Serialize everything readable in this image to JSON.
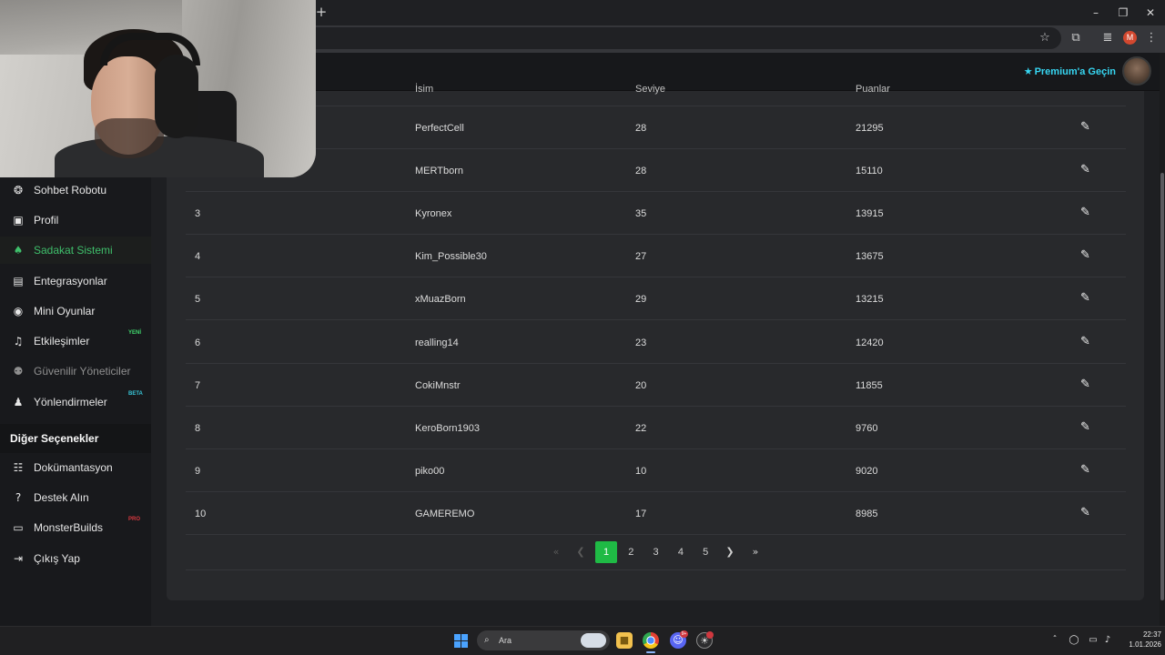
{
  "browser": {
    "new_tab": "+",
    "minimize": "–",
    "maximize": "❐",
    "close": "✕",
    "bookmark_icon": "☆",
    "extensions_icon": "⧉",
    "media_icon": "≣",
    "profile_initial": "M",
    "menu_icon": "⋮"
  },
  "header": {
    "premium_star": "★",
    "premium_label": "Premium'a Geçin"
  },
  "sidebar": {
    "items": [
      {
        "label": "Sohbet Robotu",
        "icon": "❂",
        "icon_name": "robot-icon"
      },
      {
        "label": "Profil",
        "icon": "▣",
        "icon_name": "id-card-icon"
      },
      {
        "label": "Sadakat Sistemi",
        "icon": "♠",
        "icon_name": "trophy-icon",
        "active": true
      },
      {
        "label": "Entegrasyonlar",
        "icon": "▤",
        "icon_name": "integration-icon"
      },
      {
        "label": "Mini Oyunlar",
        "icon": "◉",
        "icon_name": "gamepad-icon"
      },
      {
        "label": "Etkileşimler",
        "icon": "♫",
        "icon_name": "music-icon",
        "badge": "YENİ"
      },
      {
        "label": "Güvenilir Yöneticiler",
        "icon": "⚉",
        "icon_name": "users-cog-icon",
        "dim": true
      },
      {
        "label": "Yönlendirmeler",
        "icon": "♟",
        "icon_name": "users-icon",
        "badge": "BETA"
      }
    ],
    "section_title": "Diğer Seçenekler",
    "other_items": [
      {
        "label": "Dokümantasyon",
        "icon": "☷",
        "icon_name": "scroll-icon"
      },
      {
        "label": "Destek Alın",
        "icon": "?",
        "icon_name": "question-circle-icon"
      },
      {
        "label": "MonsterBuilds",
        "icon": "▭",
        "icon_name": "laptop-icon",
        "badge": "PRO"
      },
      {
        "label": "Çıkış Yap",
        "icon": "⇥",
        "icon_name": "logout-icon"
      }
    ]
  },
  "table": {
    "columns": [
      "",
      "İsim",
      "Seviye",
      "Puanlar",
      ""
    ],
    "edit_icon": "✎",
    "rows": [
      {
        "rank": "",
        "name": "PerfectCell",
        "level": "28",
        "points": "21295"
      },
      {
        "rank": "",
        "name": "MERTborn",
        "level": "28",
        "points": "15110"
      },
      {
        "rank": "3",
        "name": "Kyronex",
        "level": "35",
        "points": "13915"
      },
      {
        "rank": "4",
        "name": "Kim_Possible30",
        "level": "27",
        "points": "13675"
      },
      {
        "rank": "5",
        "name": "xMuazBorn",
        "level": "29",
        "points": "13215"
      },
      {
        "rank": "6",
        "name": "realling14",
        "level": "23",
        "points": "12420"
      },
      {
        "rank": "7",
        "name": "CokiMnstr",
        "level": "20",
        "points": "11855"
      },
      {
        "rank": "8",
        "name": "KeroBorn1903",
        "level": "22",
        "points": "9760"
      },
      {
        "rank": "9",
        "name": "piko00",
        "level": "10",
        "points": "9020"
      },
      {
        "rank": "10",
        "name": "GAMEREMO",
        "level": "17",
        "points": "8985"
      }
    ]
  },
  "pagination": {
    "first": "«",
    "prev": "❮",
    "pages": [
      "1",
      "2",
      "3",
      "4",
      "5"
    ],
    "current": "1",
    "next": "❯",
    "last": "»"
  },
  "taskbar": {
    "search_label": "Ara",
    "search_icon": "⌕",
    "discord_badge": "9+",
    "clock_time": "22:37",
    "clock_date": "1.01.2026"
  },
  "colors": {
    "accent_green": "#1fba45",
    "premium_cyan": "#37d6f2",
    "active_sidebar": "#3fbf6b"
  }
}
